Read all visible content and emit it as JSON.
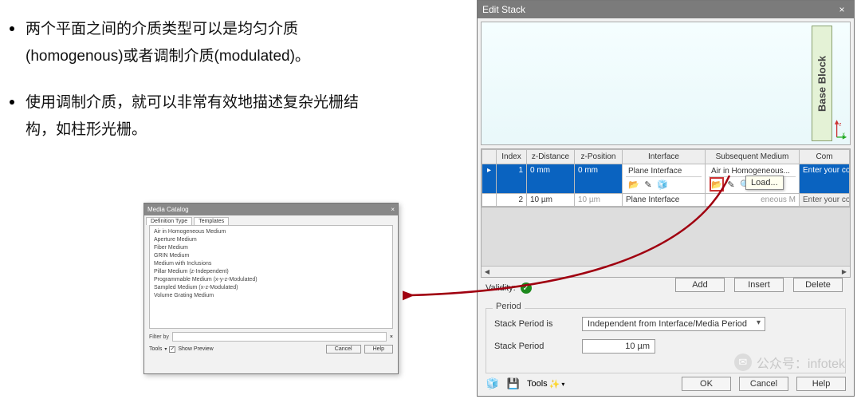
{
  "bullets": [
    "两个平面之间的介质类型可以是均匀介质(homogenous)或者调制介质(modulated)。",
    "使用调制介质，就可以非常有效地描述复杂光栅结构，如柱形光栅。"
  ],
  "media_catalog": {
    "title": "Media Catalog",
    "tabs": [
      "Definition Type",
      "Templates"
    ],
    "items": [
      "Air in Homogeneous Medium",
      "Aperture Medium",
      "Fiber Medium",
      "GRIN Medium",
      "Medium with Inclusions",
      "Pillar Medium (z-Independent)",
      "Programmable Medium (x-y-z-Modulated)",
      "Sampled Medium (x-z-Modulated)",
      "Volume Grating Medium"
    ],
    "filter_label": "Filter by",
    "tools_label": "Tools",
    "preview_label": "Show Preview",
    "cancel": "Cancel",
    "help": "Help"
  },
  "edit_stack": {
    "title": "Edit Stack",
    "base_block": "Base Block",
    "headers": [
      "",
      "Index",
      "z-Distance",
      "z-Position",
      "Interface",
      "Subsequent Medium",
      "Com"
    ],
    "rows": [
      {
        "marker": "▸",
        "index": "1",
        "zdist": "0 mm",
        "zpos": "0 mm",
        "iface": "Plane Interface",
        "medium": "Air in Homogeneous...",
        "comment": "Enter your commen",
        "selected": true
      },
      {
        "marker": "",
        "index": "2",
        "zdist": "10 µm",
        "zpos": "10 µm",
        "iface": "Plane Interface",
        "medium": "eneous M",
        "comment": "Enter your commen",
        "selected": false
      }
    ],
    "tooltip": "Load...",
    "validity_label": "Validity:",
    "add": "Add",
    "insert": "Insert",
    "delete": "Delete",
    "period_legend": "Period",
    "stack_period_is": "Stack Period is",
    "period_mode": "Independent from Interface/Media Period",
    "stack_period": "Stack Period",
    "stack_period_value": "10 µm",
    "tools": "Tools",
    "ok": "OK",
    "cancel": "Cancel",
    "help": "Help"
  },
  "watermark": "公众号：infotek"
}
